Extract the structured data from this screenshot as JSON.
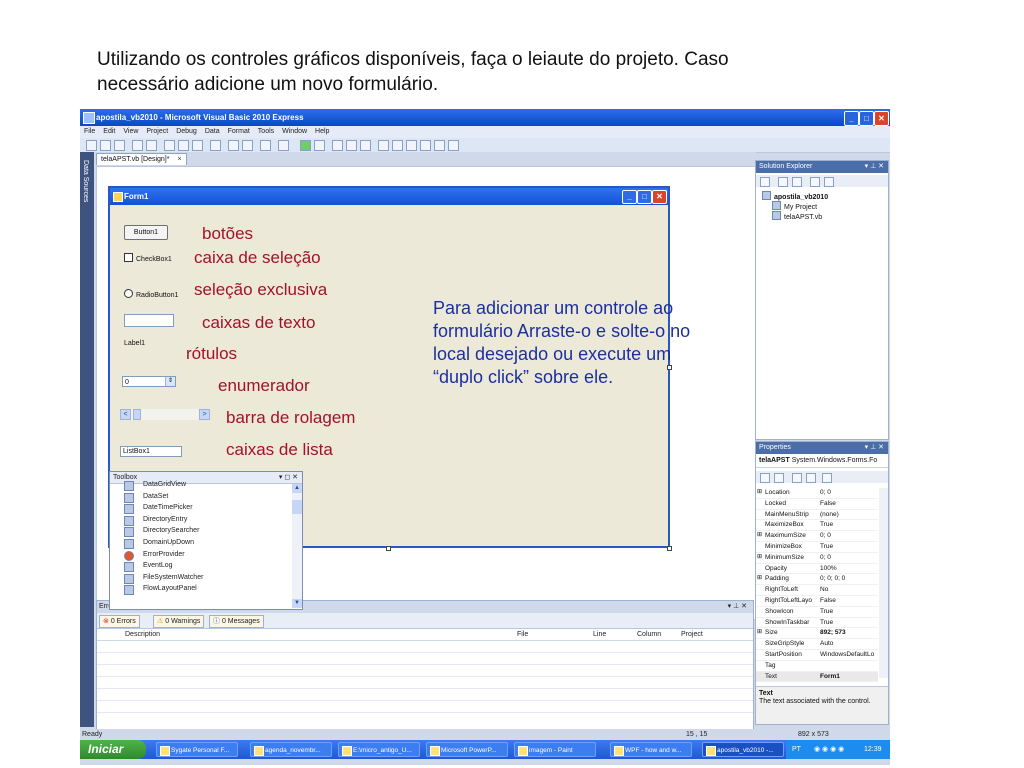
{
  "instruction": "Utilizando os controles gráficos disponíveis, faça o leiaute do projeto. Caso necessário adicione um novo formulário.",
  "vs": {
    "title": "apostila_vb2010 - Microsoft Visual Basic 2010 Express",
    "menu": [
      "File",
      "Edit",
      "View",
      "Project",
      "Debug",
      "Data",
      "Format",
      "Tools",
      "Window",
      "Help"
    ],
    "side_tab": "Data Sources",
    "doc_tab": "telaAPST.vb [Design]*",
    "doc_tab_close": "×"
  },
  "form1": {
    "title": "Form1",
    "button1": "Button1",
    "checkbox1": "CheckBox1",
    "radiobutton1": "RadioButton1",
    "label1": "Label1",
    "numeric_value": "0",
    "listbox1": "ListBox1",
    "scroll_left": "<",
    "scroll_right": ">"
  },
  "notes": {
    "botoes": "botões",
    "caixa_selecao": "caixa de seleção",
    "selecao_exclusiva": "seleção exclusiva",
    "caixas_texto": "caixas de texto",
    "rotulos": "rótulos",
    "enumerador": "enumerador",
    "barra_rolagem": "barra de rolagem",
    "caixas_lista": "caixas de lista",
    "paragraph": "Para adicionar um controle ao formulário Arraste-o e solte-o no local desejado ou execute um “duplo click” sobre ele."
  },
  "toolbox": {
    "title": "Toolbox",
    "controls": "▾ ◻ ✕",
    "items": [
      "DataGridView",
      "DataSet",
      "DateTimePicker",
      "DirectoryEntry",
      "DirectorySearcher",
      "DomainUpDown",
      "ErrorProvider",
      "EventLog",
      "FileSystemWatcher",
      "FlowLayoutPanel"
    ]
  },
  "error_list": {
    "title": "Errc",
    "controls": "▾ ⊥ ✕",
    "tabs": [
      "0 Errors",
      "0 Warnings",
      "0 Messages"
    ],
    "columns": [
      "Description",
      "File",
      "Line",
      "Column",
      "Project"
    ]
  },
  "solution_explorer": {
    "title": "Solution Explorer",
    "controls": "▾ ⊥ ✕",
    "root": "apostila_vb2010",
    "children": [
      "My Project",
      "telaAPST.vb"
    ]
  },
  "properties": {
    "title": "Properties",
    "controls": "▾ ⊥ ✕",
    "object": "telaAPST",
    "object_type": "System.Windows.Forms.Fo",
    "rows": [
      {
        "expand": "⊞",
        "name": "Location",
        "value": "0; 0"
      },
      {
        "expand": "",
        "name": "Locked",
        "value": "False"
      },
      {
        "expand": "",
        "name": "MainMenuStrip",
        "value": "(none)"
      },
      {
        "expand": "",
        "name": "MaximizeBox",
        "value": "True"
      },
      {
        "expand": "⊞",
        "name": "MaximumSize",
        "value": "0; 0"
      },
      {
        "expand": "",
        "name": "MinimizeBox",
        "value": "True"
      },
      {
        "expand": "⊞",
        "name": "MinimumSize",
        "value": "0; 0"
      },
      {
        "expand": "",
        "name": "Opacity",
        "value": "100%"
      },
      {
        "expand": "⊞",
        "name": "Padding",
        "value": "0; 0; 0; 0"
      },
      {
        "expand": "",
        "name": "RightToLeft",
        "value": "No"
      },
      {
        "expand": "",
        "name": "RightToLeftLayo",
        "value": "False"
      },
      {
        "expand": "",
        "name": "ShowIcon",
        "value": "True"
      },
      {
        "expand": "",
        "name": "ShowInTaskbar",
        "value": "True"
      },
      {
        "expand": "⊞",
        "name": "Size",
        "value": "892; 573"
      },
      {
        "expand": "",
        "name": "SizeGripStyle",
        "value": "Auto"
      },
      {
        "expand": "",
        "name": "StartPosition",
        "value": "WindowsDefaultLo"
      },
      {
        "expand": "",
        "name": "Tag",
        "value": ""
      },
      {
        "expand": "",
        "name": "Text",
        "value": "Form1"
      }
    ],
    "desc_title": "Text",
    "desc_text": "The text associated with the control."
  },
  "status": {
    "ready": "Ready",
    "position": "15 , 15",
    "size": "892 x 573"
  },
  "taskbar": {
    "start": "Iniciar",
    "tasks": [
      "Sygate Personal F...",
      "agenda_novembr...",
      "E:\\micro_antigo_U...",
      "Microsoft PowerP...",
      "imagem - Paint",
      "WPF - how and w...",
      "apostila_vb2010 -..."
    ],
    "lang": "PT",
    "clock": "12:39"
  }
}
